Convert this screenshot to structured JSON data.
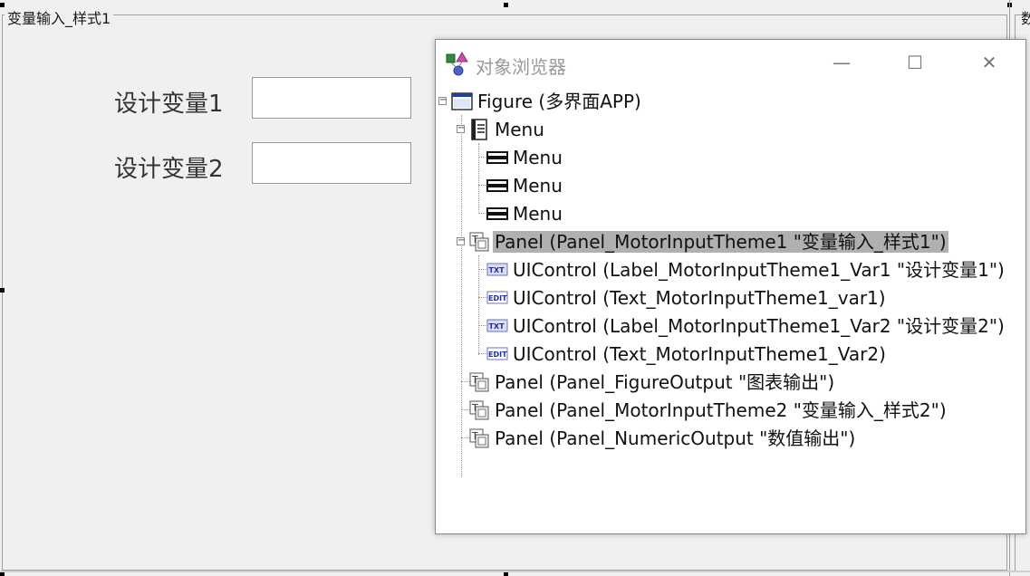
{
  "panel": {
    "title": "变量输入_样式1",
    "right_panel_title": "数"
  },
  "fields": [
    {
      "label": "设计变量1",
      "value": ""
    },
    {
      "label": "设计变量2",
      "value": ""
    }
  ],
  "browser": {
    "title": "对象浏览器",
    "controls": {
      "minimize": "—",
      "maximize": "☐",
      "close": "✕"
    },
    "tree": [
      {
        "text": "Figure (多界面APP)",
        "icon": "figure-window-icon",
        "expander": "⊟"
      },
      {
        "text": "Menu",
        "icon": "menu-doc-icon",
        "expander": "⊟"
      },
      {
        "text": "Menu",
        "icon": "menu-item-icon"
      },
      {
        "text": "Menu",
        "icon": "menu-item-icon"
      },
      {
        "text": "Menu",
        "icon": "menu-item-icon"
      },
      {
        "text": "Panel (Panel_MotorInputTheme1 \"变量输入_样式1\")",
        "icon": "panel-icon",
        "expander": "⊟",
        "selected": true
      },
      {
        "text": "UIControl (Label_MotorInputTheme1_Var1 \"设计变量1\")",
        "icon": "txt-label-icon"
      },
      {
        "text": "UIControl (Text_MotorInputTheme1_var1)",
        "icon": "edit-text-icon"
      },
      {
        "text": "UIControl (Label_MotorInputTheme1_Var2 \"设计变量2\")",
        "icon": "txt-label-icon"
      },
      {
        "text": "UIControl (Text_MotorInputTheme1_Var2)",
        "icon": "edit-text-icon"
      },
      {
        "text": "Panel (Panel_FigureOutput \"图表输出\")",
        "icon": "panel-icon"
      },
      {
        "text": "Panel (Panel_MotorInputTheme2 \"变量输入_样式2\")",
        "icon": "panel-icon"
      },
      {
        "text": "Panel (Panel_NumericOutput \"数值输出\")",
        "icon": "panel-icon"
      }
    ]
  },
  "colors": {
    "selection": "#b0b0b0",
    "canvas": "#f0f0f0",
    "title_text": "#999999"
  }
}
